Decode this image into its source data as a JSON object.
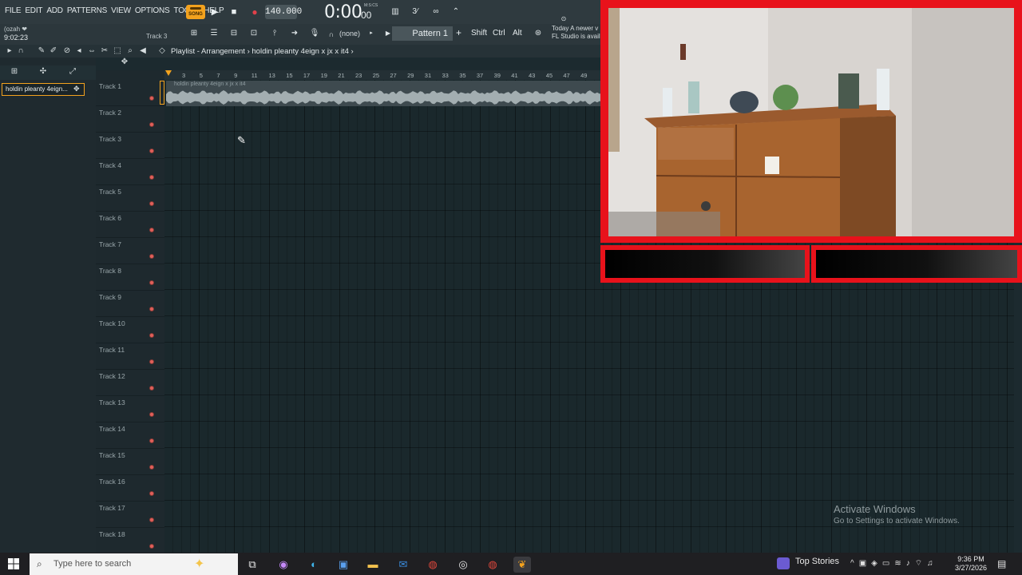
{
  "menu": [
    "FILE",
    "EDIT",
    "ADD",
    "PATTERNS",
    "VIEW",
    "OPTIONS",
    "TOOLS",
    "HELP"
  ],
  "transport": {
    "mode_badge": "SONG",
    "tempo": "140.000",
    "time": "0:00",
    "time_ms": "00",
    "time_unit": "M:S:CS"
  },
  "hint_bar": {
    "hint": "(ozah ❤",
    "clock": "9:02:23",
    "track": "Track 3"
  },
  "pattern": {
    "none_label": "(none)",
    "selected": "Pattern 1"
  },
  "modifier_keys": [
    "Shift",
    "Ctrl",
    "Alt"
  ],
  "news": {
    "line1": "Today   A newer v",
    "line2": "FL Studio is avail"
  },
  "playlist": {
    "title": "Playlist - Arrangement",
    "project": "holdin pleanty 4eign x jx x it4",
    "ruler": [
      "3",
      "5",
      "7",
      "9",
      "11",
      "13",
      "15",
      "17",
      "19",
      "21",
      "23",
      "25",
      "27",
      "29",
      "31",
      "33",
      "35",
      "37",
      "39",
      "41",
      "43",
      "45",
      "47",
      "49"
    ],
    "clip_label": "holdin pleanty 4eign x jx x it4"
  },
  "browser": {
    "pattern_item": "holdin pleanty 4eign..."
  },
  "tracks": [
    "Track 1",
    "Track 2",
    "Track 3",
    "Track 4",
    "Track 5",
    "Track 6",
    "Track 7",
    "Track 8",
    "Track 9",
    "Track 10",
    "Track 11",
    "Track 12",
    "Track 13",
    "Track 14",
    "Track 15",
    "Track 16",
    "Track 17",
    "Track 18"
  ],
  "watermark": {
    "line1": "Activate Windows",
    "line2": "Go to Settings to activate Windows."
  },
  "taskbar": {
    "search_placeholder": "Type here to search",
    "news_widget": "Top Stories",
    "time": "9:36 PM",
    "date": "3/27/2026"
  },
  "colors": {
    "accent_orange": "#f3a21e",
    "overlay_red": "#e8121b",
    "record_red": "#e0414a"
  }
}
